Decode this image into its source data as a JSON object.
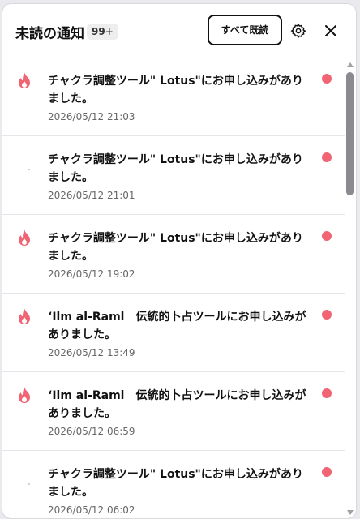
{
  "header": {
    "title": "未読の通知",
    "count": "99+",
    "mark_all_read": "すべて既読",
    "icons": {
      "settings": "gear-icon",
      "close": "close-icon"
    }
  },
  "colors": {
    "unread_dot": "#f06473",
    "fire": "#f06473"
  },
  "notifications": [
    {
      "message": "チャクラ調整ツール\" Lotus\"にお申し込みがありました。",
      "time": "2026/05/12 21:03",
      "icon": "fire-icon"
    },
    {
      "message": "チャクラ調整ツール\" Lotus\"にお申し込みがありました。",
      "time": "2026/05/12 21:01",
      "icon": ""
    },
    {
      "message": "チャクラ調整ツール\" Lotus\"にお申し込みがありました。",
      "time": "2026/05/12 19:02",
      "icon": "fire-icon"
    },
    {
      "message": "‘Ilm al-Raml　伝統的卜占ツールにお申し込みがありました。",
      "time": "2026/05/12 13:49",
      "icon": "fire-icon"
    },
    {
      "message": "‘Ilm al-Raml　伝統的卜占ツールにお申し込みがありました。",
      "time": "2026/05/12 06:59",
      "icon": "fire-icon"
    },
    {
      "message": "チャクラ調整ツール\" Lotus\"にお申し込みがありました。",
      "time": "2026/05/12 06:02",
      "icon": ""
    }
  ]
}
